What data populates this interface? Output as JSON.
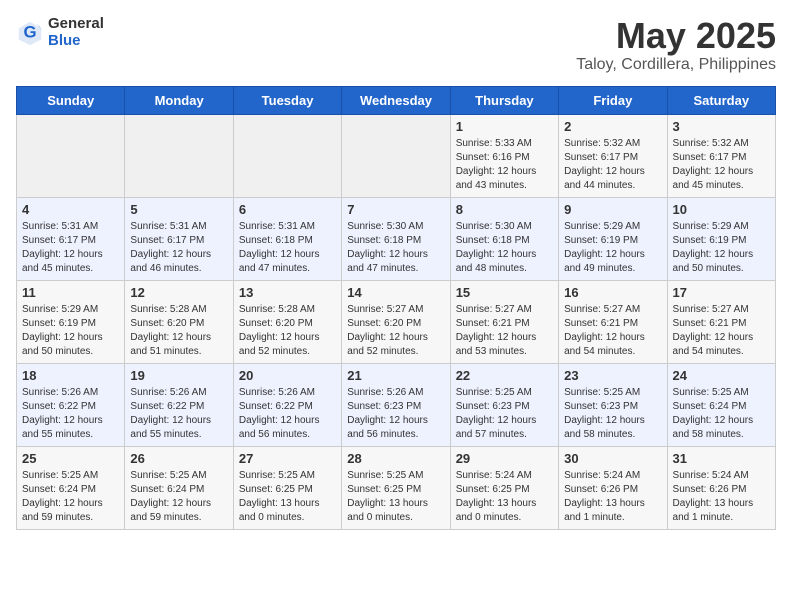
{
  "logo": {
    "line1": "General",
    "line2": "Blue"
  },
  "title": "May 2025",
  "location": "Taloy, Cordillera, Philippines",
  "days_of_week": [
    "Sunday",
    "Monday",
    "Tuesday",
    "Wednesday",
    "Thursday",
    "Friday",
    "Saturday"
  ],
  "weeks": [
    [
      {
        "day": "",
        "content": ""
      },
      {
        "day": "",
        "content": ""
      },
      {
        "day": "",
        "content": ""
      },
      {
        "day": "",
        "content": ""
      },
      {
        "day": "1",
        "content": "Sunrise: 5:33 AM\nSunset: 6:16 PM\nDaylight: 12 hours\nand 43 minutes."
      },
      {
        "day": "2",
        "content": "Sunrise: 5:32 AM\nSunset: 6:17 PM\nDaylight: 12 hours\nand 44 minutes."
      },
      {
        "day": "3",
        "content": "Sunrise: 5:32 AM\nSunset: 6:17 PM\nDaylight: 12 hours\nand 45 minutes."
      }
    ],
    [
      {
        "day": "4",
        "content": "Sunrise: 5:31 AM\nSunset: 6:17 PM\nDaylight: 12 hours\nand 45 minutes."
      },
      {
        "day": "5",
        "content": "Sunrise: 5:31 AM\nSunset: 6:17 PM\nDaylight: 12 hours\nand 46 minutes."
      },
      {
        "day": "6",
        "content": "Sunrise: 5:31 AM\nSunset: 6:18 PM\nDaylight: 12 hours\nand 47 minutes."
      },
      {
        "day": "7",
        "content": "Sunrise: 5:30 AM\nSunset: 6:18 PM\nDaylight: 12 hours\nand 47 minutes."
      },
      {
        "day": "8",
        "content": "Sunrise: 5:30 AM\nSunset: 6:18 PM\nDaylight: 12 hours\nand 48 minutes."
      },
      {
        "day": "9",
        "content": "Sunrise: 5:29 AM\nSunset: 6:19 PM\nDaylight: 12 hours\nand 49 minutes."
      },
      {
        "day": "10",
        "content": "Sunrise: 5:29 AM\nSunset: 6:19 PM\nDaylight: 12 hours\nand 50 minutes."
      }
    ],
    [
      {
        "day": "11",
        "content": "Sunrise: 5:29 AM\nSunset: 6:19 PM\nDaylight: 12 hours\nand 50 minutes."
      },
      {
        "day": "12",
        "content": "Sunrise: 5:28 AM\nSunset: 6:20 PM\nDaylight: 12 hours\nand 51 minutes."
      },
      {
        "day": "13",
        "content": "Sunrise: 5:28 AM\nSunset: 6:20 PM\nDaylight: 12 hours\nand 52 minutes."
      },
      {
        "day": "14",
        "content": "Sunrise: 5:27 AM\nSunset: 6:20 PM\nDaylight: 12 hours\nand 52 minutes."
      },
      {
        "day": "15",
        "content": "Sunrise: 5:27 AM\nSunset: 6:21 PM\nDaylight: 12 hours\nand 53 minutes."
      },
      {
        "day": "16",
        "content": "Sunrise: 5:27 AM\nSunset: 6:21 PM\nDaylight: 12 hours\nand 54 minutes."
      },
      {
        "day": "17",
        "content": "Sunrise: 5:27 AM\nSunset: 6:21 PM\nDaylight: 12 hours\nand 54 minutes."
      }
    ],
    [
      {
        "day": "18",
        "content": "Sunrise: 5:26 AM\nSunset: 6:22 PM\nDaylight: 12 hours\nand 55 minutes."
      },
      {
        "day": "19",
        "content": "Sunrise: 5:26 AM\nSunset: 6:22 PM\nDaylight: 12 hours\nand 55 minutes."
      },
      {
        "day": "20",
        "content": "Sunrise: 5:26 AM\nSunset: 6:22 PM\nDaylight: 12 hours\nand 56 minutes."
      },
      {
        "day": "21",
        "content": "Sunrise: 5:26 AM\nSunset: 6:23 PM\nDaylight: 12 hours\nand 56 minutes."
      },
      {
        "day": "22",
        "content": "Sunrise: 5:25 AM\nSunset: 6:23 PM\nDaylight: 12 hours\nand 57 minutes."
      },
      {
        "day": "23",
        "content": "Sunrise: 5:25 AM\nSunset: 6:23 PM\nDaylight: 12 hours\nand 58 minutes."
      },
      {
        "day": "24",
        "content": "Sunrise: 5:25 AM\nSunset: 6:24 PM\nDaylight: 12 hours\nand 58 minutes."
      }
    ],
    [
      {
        "day": "25",
        "content": "Sunrise: 5:25 AM\nSunset: 6:24 PM\nDaylight: 12 hours\nand 59 minutes."
      },
      {
        "day": "26",
        "content": "Sunrise: 5:25 AM\nSunset: 6:24 PM\nDaylight: 12 hours\nand 59 minutes."
      },
      {
        "day": "27",
        "content": "Sunrise: 5:25 AM\nSunset: 6:25 PM\nDaylight: 13 hours\nand 0 minutes."
      },
      {
        "day": "28",
        "content": "Sunrise: 5:25 AM\nSunset: 6:25 PM\nDaylight: 13 hours\nand 0 minutes."
      },
      {
        "day": "29",
        "content": "Sunrise: 5:24 AM\nSunset: 6:25 PM\nDaylight: 13 hours\nand 0 minutes."
      },
      {
        "day": "30",
        "content": "Sunrise: 5:24 AM\nSunset: 6:26 PM\nDaylight: 13 hours\nand 1 minute."
      },
      {
        "day": "31",
        "content": "Sunrise: 5:24 AM\nSunset: 6:26 PM\nDaylight: 13 hours\nand 1 minute."
      }
    ]
  ]
}
